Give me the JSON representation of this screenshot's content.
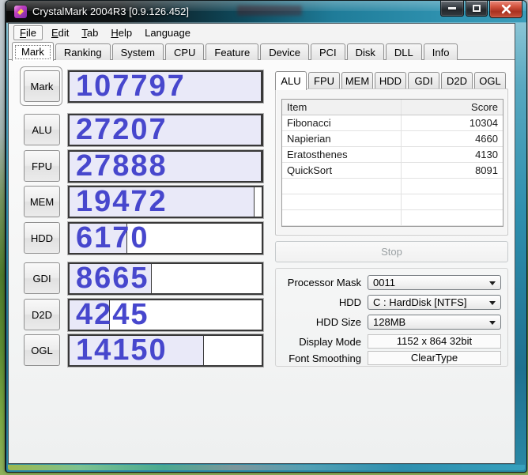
{
  "window": {
    "title": "CrystalMark 2004R3 [0.9.126.452]"
  },
  "menu": {
    "items": [
      {
        "mnemonic": "F",
        "rest": "ile"
      },
      {
        "mnemonic": "E",
        "rest": "dit"
      },
      {
        "mnemonic": "T",
        "rest": "ab"
      },
      {
        "mnemonic": "H",
        "rest": "elp"
      },
      {
        "mnemonic": "",
        "rest": "Language"
      }
    ]
  },
  "tabs": {
    "active": "Mark",
    "items": [
      "Mark",
      "Ranking",
      "System",
      "CPU",
      "Feature",
      "Device",
      "PCI",
      "Disk",
      "DLL",
      "Info"
    ]
  },
  "bench": {
    "rows": [
      {
        "label": "Mark",
        "value": "107797",
        "fill": 100
      },
      {
        "label": "ALU",
        "value": "27207",
        "fill": 100
      },
      {
        "label": "FPU",
        "value": "27888",
        "fill": 100
      },
      {
        "label": "MEM",
        "value": "19472",
        "fill": 96.5
      },
      {
        "label": "HDD",
        "value": "6170",
        "fill": 30
      },
      {
        "label": "GDI",
        "value": "8665",
        "fill": 43
      },
      {
        "label": "D2D",
        "value": "4245",
        "fill": 21
      },
      {
        "label": "OGL",
        "value": "14150",
        "fill": 70
      }
    ]
  },
  "detail": {
    "active_tab": "ALU",
    "tabs": [
      "ALU",
      "FPU",
      "MEM",
      "HDD",
      "GDI",
      "D2D",
      "OGL"
    ],
    "table": {
      "columns": [
        "Item",
        "Score"
      ],
      "rows": [
        {
          "item": "Fibonacci",
          "score": "10304"
        },
        {
          "item": "Napierian",
          "score": "4660"
        },
        {
          "item": "Eratosthenes",
          "score": "4130"
        },
        {
          "item": "QuickSort",
          "score": "8091"
        }
      ]
    }
  },
  "controls": {
    "stop": "Stop",
    "fields": [
      {
        "label": "Processor Mask",
        "value": "0011"
      },
      {
        "label": "HDD",
        "value": "C : HardDisk [NTFS]"
      },
      {
        "label": "HDD Size",
        "value": "128MB"
      },
      {
        "label": "Display Mode",
        "value": "1152 x 864 32bit"
      },
      {
        "label": "Font Smoothing",
        "value": "ClearType"
      }
    ]
  },
  "colors": {
    "score_text": "#4747CD",
    "bar_fill": "#E9E9F8",
    "close_button": "#C9413A",
    "frame_teal": "#2E8FAE"
  }
}
